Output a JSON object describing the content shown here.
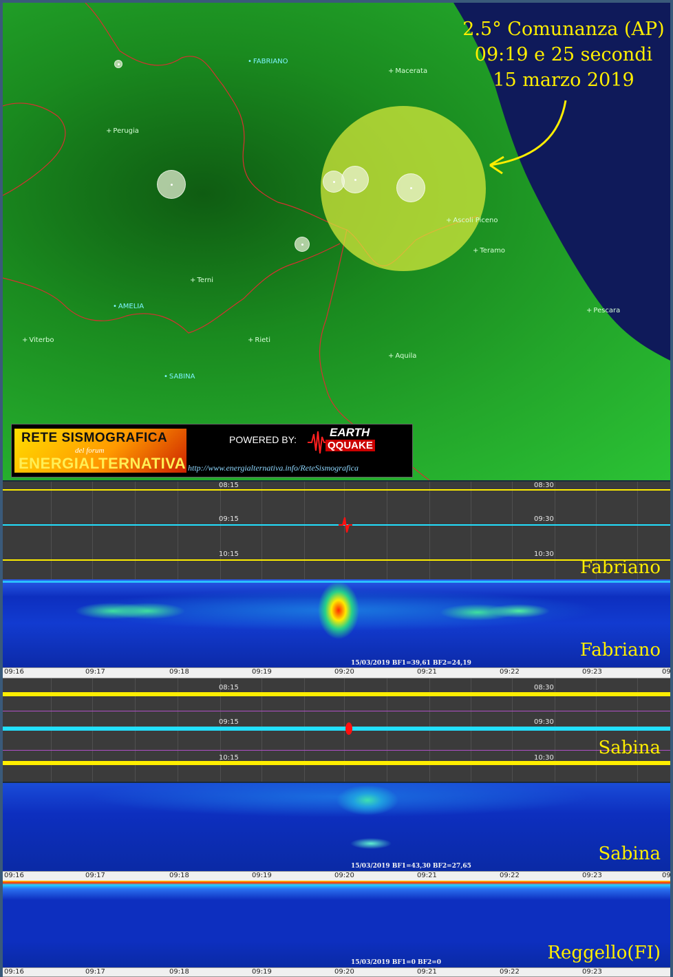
{
  "annotation": {
    "line1": "2.5° Comunanza (AP)",
    "line2": "09:19 e 25 secondi",
    "line3": "15 marzo 2019"
  },
  "cities": {
    "fabriano": "FABRIANO",
    "macerata": "Macerata",
    "perugia": "Perugia",
    "ascoli": "Ascoli Piceno",
    "teramo": "Teramo",
    "terni": "Terni",
    "amelia": "AMELIA",
    "pescara": "Pescara",
    "viterbo": "Viterbo",
    "rieti": "Rieti",
    "aquila": "Aquila",
    "sabina": "SABINA"
  },
  "logo": {
    "line1": "RETE SISMOGRAFICA",
    "line2": "del forum",
    "line3": "ENERGIALTERNATIVA",
    "powered": "POWERED BY:",
    "brand1": "EARTH",
    "brand2": "QQUAKE",
    "url": "http://www.energialternativa.info/ReteSismografica"
  },
  "helicorder_fabriano": {
    "station": "Fabriano",
    "left_labels": [
      "08:15",
      "09:15",
      "10:15"
    ],
    "right_labels": [
      "08:30",
      "09:30",
      "10:30"
    ]
  },
  "spectro_fabriano": {
    "station": "Fabriano",
    "caption": "15/03/2019 BF1=39,61 BF2=24,19"
  },
  "timebar": [
    "09:16",
    "09:17",
    "09:18",
    "09:19",
    "09:20",
    "09:21",
    "09:22",
    "09:23",
    "09"
  ],
  "helicorder_sabina": {
    "station": "Sabina",
    "left_labels": [
      "08:15",
      "09:15",
      "10:15"
    ],
    "right_labels": [
      "08:30",
      "09:30",
      "10:30"
    ]
  },
  "spectro_sabina": {
    "station": "Sabina",
    "caption": "15/03/2019 BF1=43,30 BF2=27,65"
  },
  "spectro_reggello": {
    "station": "Reggello(FI)",
    "caption": "15/03/2019 BF1=0 BF2=0"
  },
  "colors": {
    "annotation": "#ffee00",
    "event_circle": "#dceb3c",
    "trace_yellow": "#ffee00",
    "trace_cyan": "#22e0ff",
    "event_marker": "#ff1010"
  }
}
